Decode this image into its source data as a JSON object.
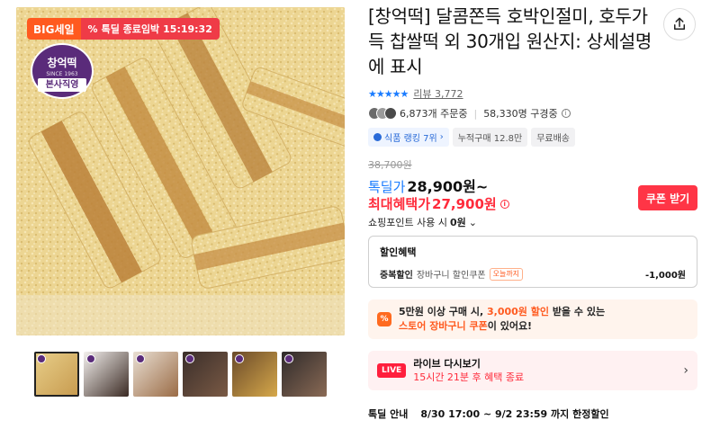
{
  "image": {
    "sale_badge": "BIG세일",
    "deal_timer_prefix": "%",
    "deal_timer_label": "톡딜 종료임박",
    "deal_timer_time": "15:19:32",
    "brand_name": "창억떡",
    "brand_since": "SINCE 1963",
    "brand_direct": "본사직영",
    "thumbnails": [
      {
        "name": "thumb-injeolmi",
        "colors": [
          "#e8cf8a",
          "#c79a4e"
        ],
        "active": true
      },
      {
        "name": "thumb-model",
        "colors": [
          "#f4f1ee",
          "#3b2a24"
        ],
        "active": false
      },
      {
        "name": "thumb-walnut",
        "colors": [
          "#e9dfd3",
          "#9a6b45"
        ],
        "active": false
      },
      {
        "name": "thumb-chapssal",
        "colors": [
          "#3a2e2a",
          "#7a5a45"
        ],
        "active": false
      },
      {
        "name": "thumb-assorted",
        "colors": [
          "#6a4a2a",
          "#d6a84a"
        ],
        "active": false
      },
      {
        "name": "thumb-dark",
        "colors": [
          "#2e2a2a",
          "#8a6a55"
        ],
        "active": false
      }
    ]
  },
  "product": {
    "title": "[창억떡] 달콤쫀득 호박인절미, 호두가득 찹쌀떡 외 30개입 원산지: 상세설명에 표시",
    "stars": "★★★★★",
    "review_label": "리뷰 3,772",
    "orders": "6,873개 주문중",
    "watchers": "58,330명 구경중",
    "info_icon": "i",
    "chips": {
      "rank": "식품 랭킹 7위",
      "rank_arrow": "›",
      "cumulative": "누적구매 12.8만",
      "shipping": "무료배송"
    },
    "original_price": "38,700원",
    "deal_label": "톡딜가",
    "deal_price": "28,900원~",
    "max_label": "최대혜택가",
    "max_price": "27,900원",
    "coupon_button": "쿠폰 받기",
    "points_label": "쇼핑포인트 사용 시",
    "points_value": "0원",
    "points_chevron": "⌄",
    "share_icon": "share-icon"
  },
  "discount": {
    "header": "할인혜택",
    "row_label": "중복할인",
    "row_desc": "장바구니 할인쿠폰",
    "row_tag": "오늘까지",
    "row_amount": "-1,000원"
  },
  "promo": {
    "icon": "%",
    "line1_pre": "5만원 이상 구매 시, ",
    "line1_hl": "3,000원 할인",
    "line1_post": " 받을 수 있는",
    "line2_hl": "스토어 장바구니 쿠폰",
    "line2_post": "이 있어요!"
  },
  "live": {
    "badge": "LIVE",
    "title": "라이브 다시보기",
    "subtitle": "15시간 21분 후 혜택 종료",
    "arrow": "›"
  },
  "deal_info": {
    "label": "톡딜 안내",
    "value": "8/30 17:00 ~ 9/2 23:59 까지 한정할인"
  },
  "colors": {
    "accent_red": "#ff2b3b",
    "accent_blue": "#1a7cff",
    "sale_orange": "#ff5a1f",
    "brand_purple": "#5a2b7a"
  }
}
